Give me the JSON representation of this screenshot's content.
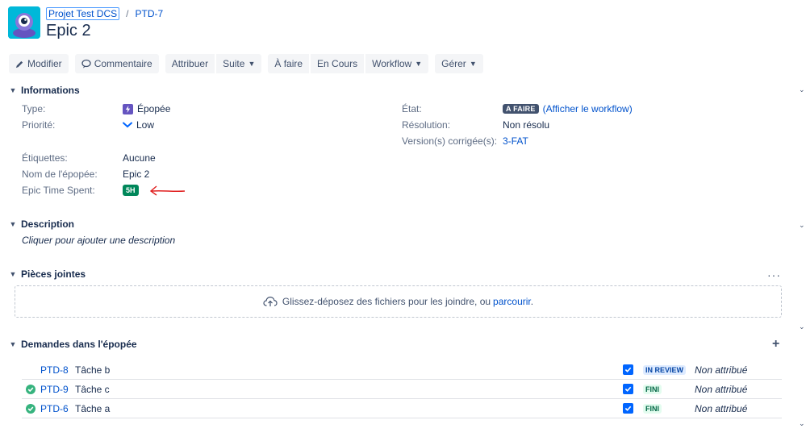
{
  "breadcrumb": {
    "project": "Projet Test DCS",
    "separator": "/",
    "issue_key": "PTD-7"
  },
  "issue": {
    "title": "Epic 2"
  },
  "toolbar": {
    "edit": "Modifier",
    "comment": "Commentaire",
    "assign": "Attribuer",
    "more": "Suite",
    "todo": "À faire",
    "in_progress": "En Cours",
    "workflow": "Workflow",
    "manage": "Gérer"
  },
  "details": {
    "heading": "Informations",
    "type_label": "Type:",
    "type_value": "Épopée",
    "priority_label": "Priorité:",
    "priority_value": "Low",
    "labels_label": "Étiquettes:",
    "labels_value": "Aucune",
    "epic_name_label": "Nom de l'épopée:",
    "epic_name_value": "Epic 2",
    "epic_time_label": "Epic Time Spent:",
    "epic_time_value": "5H",
    "status_label": "État:",
    "status_value": "A FAIRE",
    "workflow_link": "(Afficher le workflow)",
    "resolution_label": "Résolution:",
    "resolution_value": "Non résolu",
    "fix_version_label": "Version(s) corrigée(s):",
    "fix_version_value": "3-FAT"
  },
  "description": {
    "heading": "Description",
    "placeholder": "Cliquer pour ajouter une description"
  },
  "attachments": {
    "heading": "Pièces jointes",
    "more": "···",
    "drop_text": "Glissez-déposez des fichiers pour les joindre, ou",
    "browse_link": "parcourir",
    "period": "."
  },
  "epic_issues": {
    "heading": "Demandes dans l'épopée",
    "add": "+",
    "rows": [
      {
        "key": "PTD-8",
        "summary": "Tâche b",
        "status": "IN REVIEW",
        "assignee": "Non attribué",
        "done": false
      },
      {
        "key": "PTD-9",
        "summary": "Tâche c",
        "status": "FINI",
        "assignee": "Non attribué",
        "done": true
      },
      {
        "key": "PTD-6",
        "summary": "Tâche a",
        "status": "FINI",
        "assignee": "Non attribué",
        "done": true
      }
    ]
  },
  "colors": {
    "link": "#0052cc",
    "epic": "#6554c0",
    "done_green": "#36b37e",
    "annotation_arrow": "#e01e1e"
  }
}
